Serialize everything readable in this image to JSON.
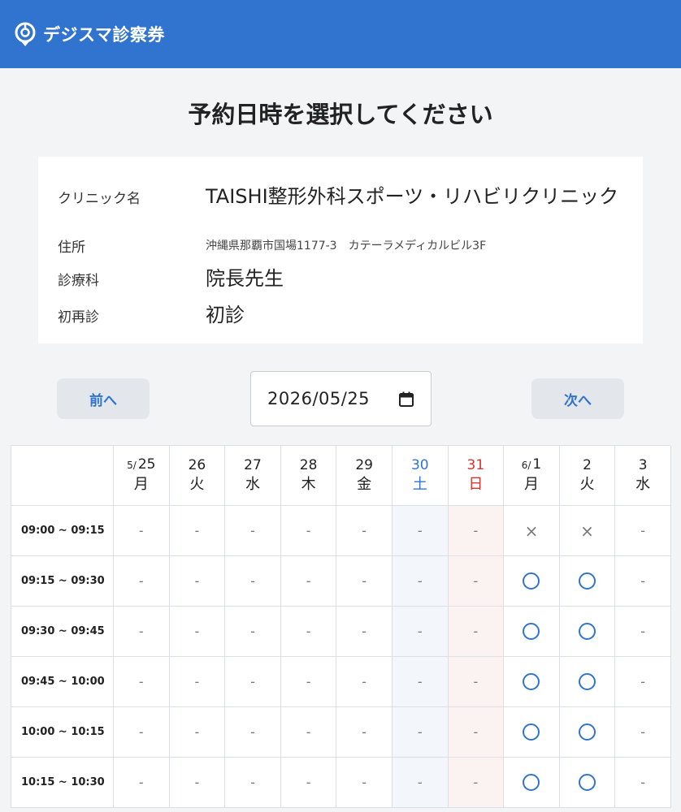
{
  "app": {
    "name": "デジスマ診察券"
  },
  "page": {
    "title": "予約日時を選択してください"
  },
  "clinic": {
    "rows": [
      {
        "label": "クリニック名",
        "value": "TAISHI整形外科スポーツ・リハビリクリニック"
      },
      {
        "label": "住所",
        "value": "沖縄県那覇市国場1177-3　カテーラメディカルビル3F"
      },
      {
        "label": "診療科",
        "value": "院長先生"
      },
      {
        "label": "初再診",
        "value": "初診"
      }
    ]
  },
  "nav": {
    "prev_label": "前へ",
    "next_label": "次へ",
    "date_value": "2026/05/25"
  },
  "schedule": {
    "days": [
      {
        "prefix": "5/",
        "day": "25",
        "weekday": "月",
        "type": "weekday"
      },
      {
        "prefix": "",
        "day": "26",
        "weekday": "火",
        "type": "weekday"
      },
      {
        "prefix": "",
        "day": "27",
        "weekday": "水",
        "type": "weekday"
      },
      {
        "prefix": "",
        "day": "28",
        "weekday": "木",
        "type": "weekday"
      },
      {
        "prefix": "",
        "day": "29",
        "weekday": "金",
        "type": "weekday"
      },
      {
        "prefix": "",
        "day": "30",
        "weekday": "土",
        "type": "sat"
      },
      {
        "prefix": "",
        "day": "31",
        "weekday": "日",
        "type": "sun"
      },
      {
        "prefix": "6/",
        "day": "1",
        "weekday": "月",
        "type": "weekday"
      },
      {
        "prefix": "",
        "day": "2",
        "weekday": "火",
        "type": "weekday"
      },
      {
        "prefix": "",
        "day": "3",
        "weekday": "水",
        "type": "weekday"
      }
    ],
    "slots": [
      {
        "time": "09:00 ~ 09:15",
        "marks": [
          "-",
          "-",
          "-",
          "-",
          "-",
          "-",
          "-",
          "×",
          "×",
          "-"
        ]
      },
      {
        "time": "09:15 ~ 09:30",
        "marks": [
          "-",
          "-",
          "-",
          "-",
          "-",
          "-",
          "-",
          "○",
          "○",
          "-"
        ]
      },
      {
        "time": "09:30 ~ 09:45",
        "marks": [
          "-",
          "-",
          "-",
          "-",
          "-",
          "-",
          "-",
          "○",
          "○",
          "-"
        ]
      },
      {
        "time": "09:45 ~ 10:00",
        "marks": [
          "-",
          "-",
          "-",
          "-",
          "-",
          "-",
          "-",
          "○",
          "○",
          "-"
        ]
      },
      {
        "time": "10:00 ~ 10:15",
        "marks": [
          "-",
          "-",
          "-",
          "-",
          "-",
          "-",
          "-",
          "○",
          "○",
          "-"
        ]
      },
      {
        "time": "10:15 ~ 10:30",
        "marks": [
          "-",
          "-",
          "-",
          "-",
          "-",
          "-",
          "-",
          "○",
          "○",
          "-"
        ]
      }
    ]
  },
  "colors": {
    "brand": "#3174cf",
    "saturday": "#3174cf",
    "sunday": "#d0382f"
  }
}
